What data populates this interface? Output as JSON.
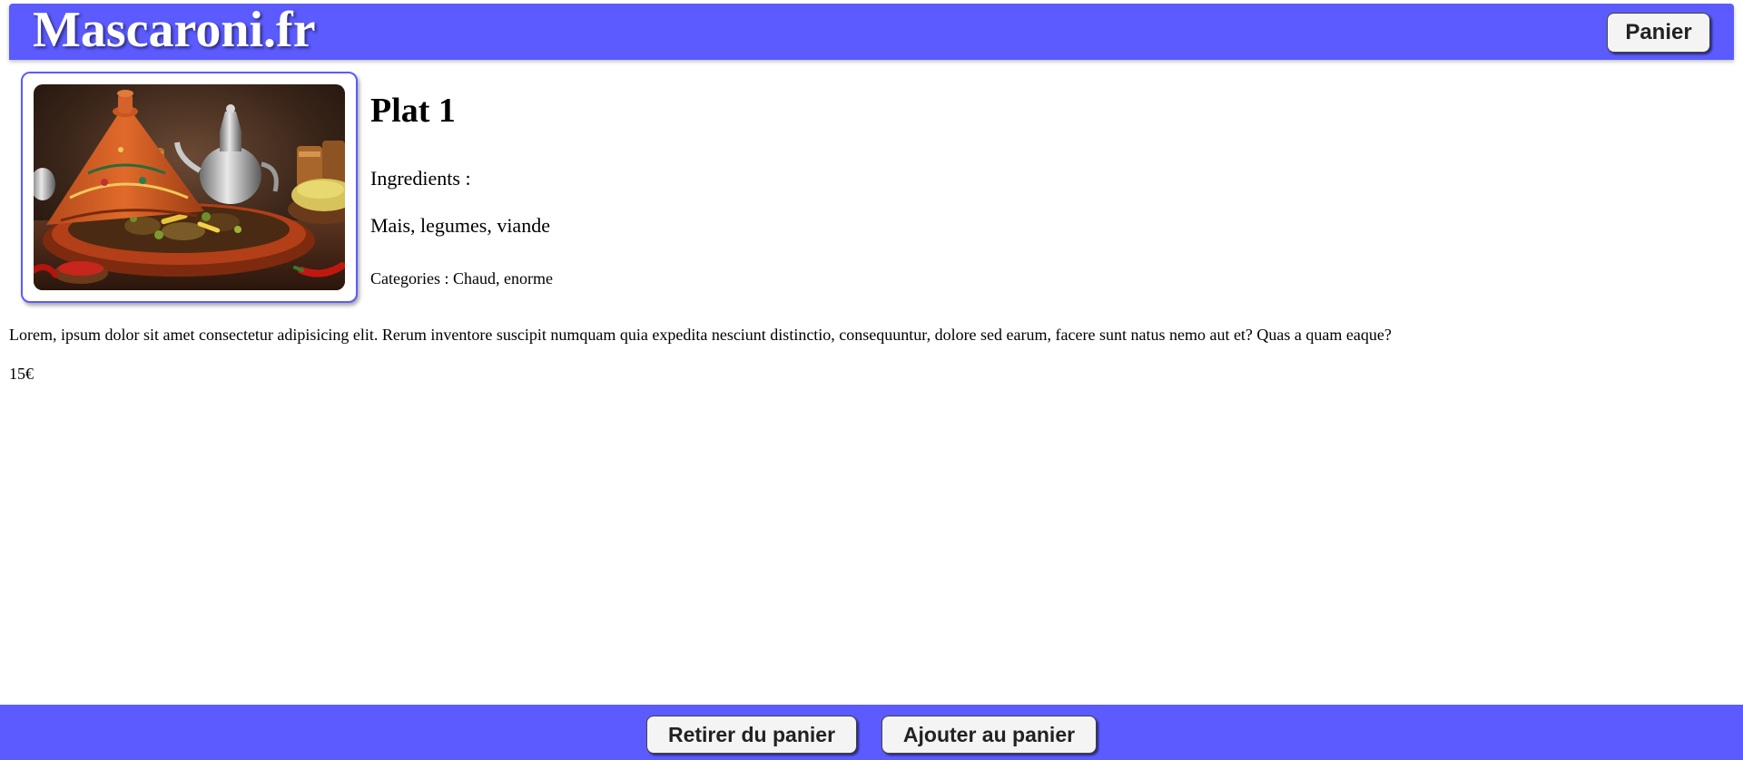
{
  "header": {
    "brand": "Mascaroni.fr",
    "cart_label": "Panier",
    "color": "#5b5bff"
  },
  "product": {
    "image_icon": "tajine-photo",
    "title": "Plat 1",
    "ingredients_label": "Ingredients :",
    "ingredients": "Mais, legumes, viande",
    "categories": "Categories : Chaud, enorme",
    "description": "Lorem, ipsum dolor sit amet consectetur adipisicing elit. Rerum inventore suscipit numquam quia expedita nesciunt distinctio, consequuntur, dolore sed earum, facere sunt natus nemo aut et? Quas a quam eaque?",
    "price": "15€"
  },
  "footer": {
    "remove_label": "Retirer du panier",
    "add_label": "Ajouter au panier"
  }
}
